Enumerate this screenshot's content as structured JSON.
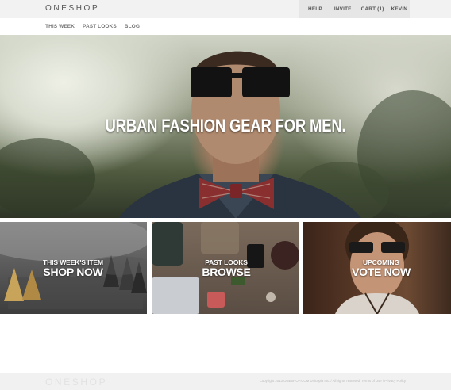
{
  "header": {
    "logo": "ONESHOP",
    "util_nav": [
      "HELP",
      "INVITE",
      "CART (1)",
      "KEVIN"
    ]
  },
  "subnav": [
    "THIS WEEK",
    "PAST LOOKS",
    "BLOG"
  ],
  "hero": {
    "headline": "URBAN FASHION GEAR FOR MEN."
  },
  "tiles": [
    {
      "kicker": "THIS WEEK'S ITEM",
      "cta": "SHOP NOW"
    },
    {
      "kicker": "PAST LOOKS",
      "cta": "BROWSE"
    },
    {
      "kicker": "UPCOMING",
      "cta": "VOTE NOW"
    }
  ],
  "footer": {
    "logo": "ONESHOP",
    "copyright": "Copyright 2013 ONESHOP.COM Unicopia Inc. / All rights reserved. Terms of Use / Privacy Policy"
  },
  "colors": {
    "topbar": "#f2f2f2",
    "util_nav_bg": "#e6e6e6",
    "footer": "#f1f1f1"
  }
}
